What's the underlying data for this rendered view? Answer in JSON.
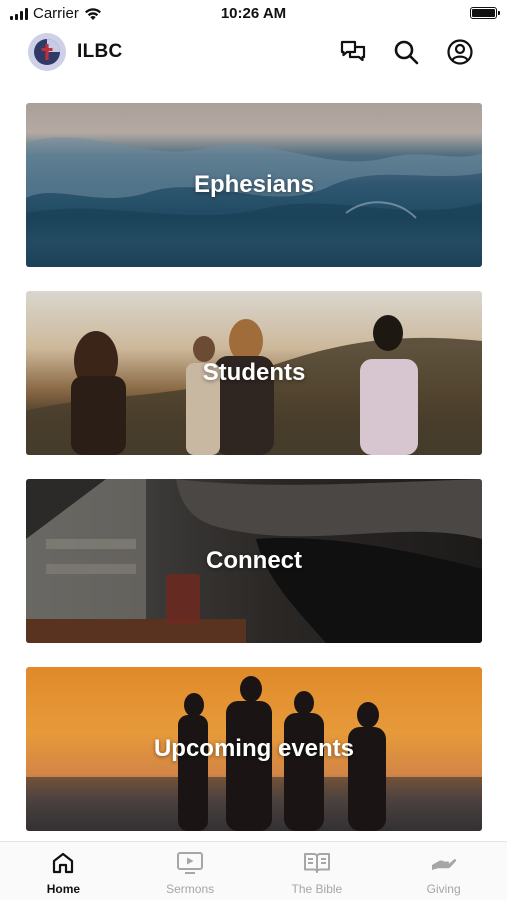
{
  "status_bar": {
    "carrier": "Carrier",
    "time": "10:26 AM"
  },
  "header": {
    "title": "ILBC",
    "icons": [
      "chat-icon",
      "search-icon",
      "account-icon"
    ]
  },
  "cards": [
    {
      "label": "Ephesians"
    },
    {
      "label": "Students"
    },
    {
      "label": "Connect"
    },
    {
      "label": "Upcoming events"
    }
  ],
  "tabs": [
    {
      "label": "Home",
      "icon": "home-icon",
      "active": true
    },
    {
      "label": "Sermons",
      "icon": "video-icon",
      "active": false
    },
    {
      "label": "The Bible",
      "icon": "book-icon",
      "active": false
    },
    {
      "label": "Giving",
      "icon": "giving-hand-icon",
      "active": false
    }
  ],
  "colors": {
    "active_tab": "#111111",
    "inactive_tab": "#a6a6a6",
    "logo_background": "#cdd0e6"
  }
}
